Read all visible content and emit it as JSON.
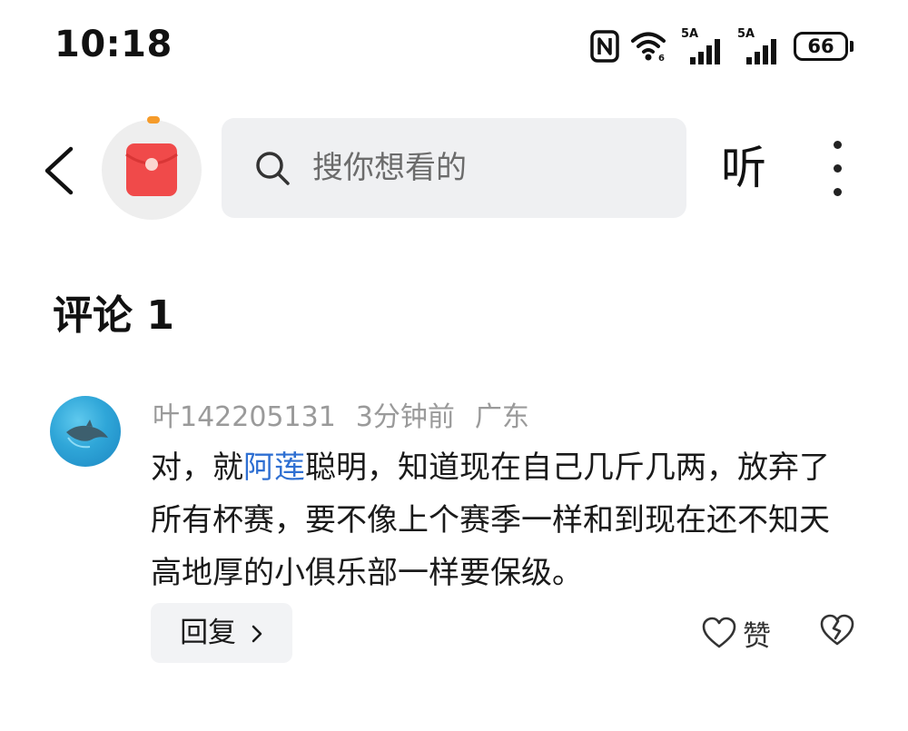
{
  "status_bar": {
    "time": "10:18",
    "nfc_label": "N",
    "signal1_label": "5A",
    "signal2_label": "5A",
    "battery": "66"
  },
  "header": {
    "search_placeholder": "搜你想看的",
    "listen_label": "听"
  },
  "comments": {
    "title": "评论 1",
    "items": [
      {
        "user": "叶142205131",
        "time": "3分钟前",
        "location": "广东",
        "text_before": "对，就",
        "mention": "阿莲",
        "text_after": "聪明，知道现在自己几斤几两，放弃了所有杯赛，要不像上个赛季一样和到现在还不知天高地厚的小俱乐部一样要保级。",
        "reply_label": "回复",
        "like_label": "赞"
      }
    ]
  },
  "colors": {
    "accent_link": "#2e6fd2",
    "app_icon_red": "#f04a4a",
    "app_icon_dot": "#f59b2a",
    "search_bg": "#eff0f2"
  }
}
